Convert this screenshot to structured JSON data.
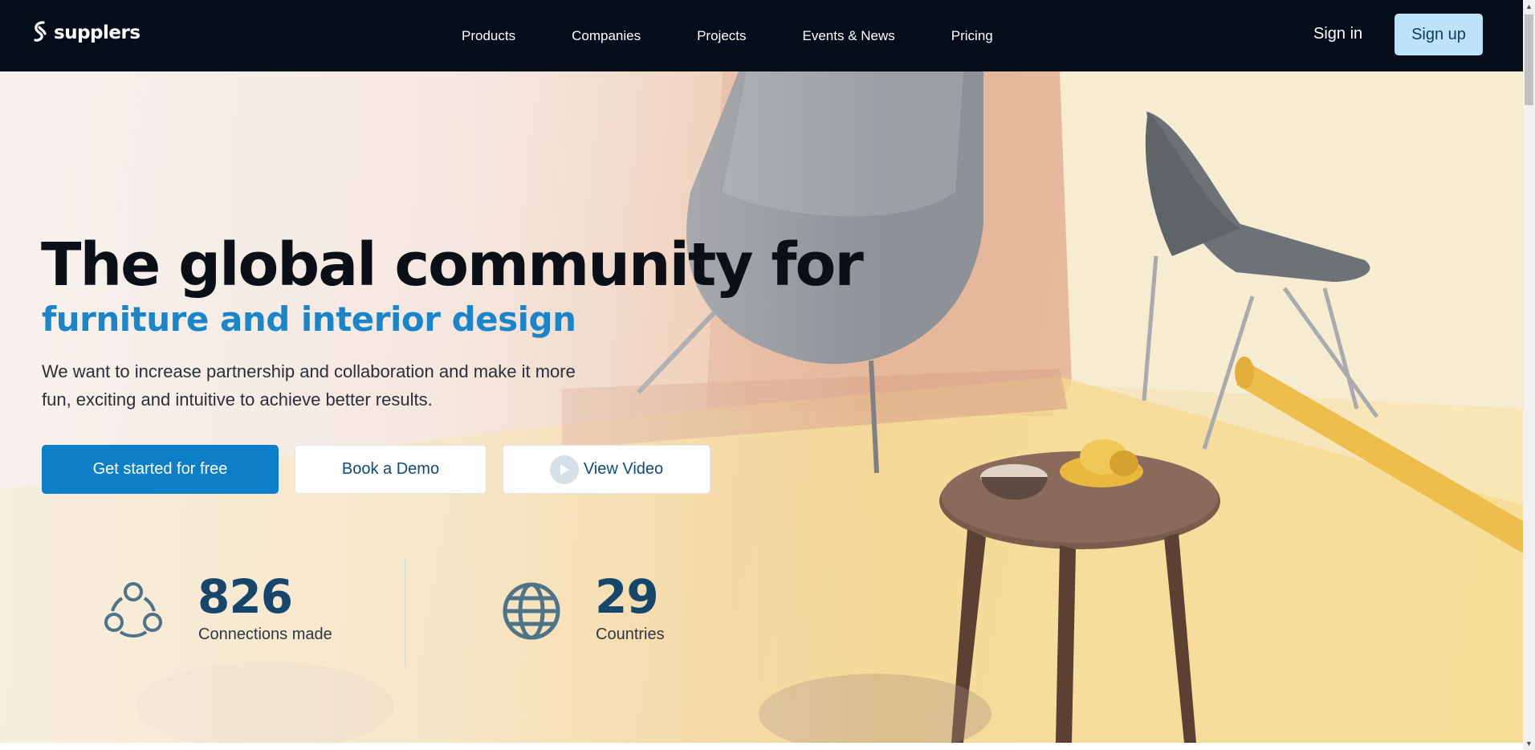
{
  "brand": {
    "name": "supplers"
  },
  "nav": {
    "items": [
      {
        "label": "Products"
      },
      {
        "label": "Companies"
      },
      {
        "label": "Projects"
      },
      {
        "label": "Events & News"
      },
      {
        "label": "Pricing"
      }
    ],
    "sign_in": "Sign in",
    "sign_up": "Sign up"
  },
  "hero": {
    "headline": "The global community for",
    "subheadline": "furniture and interior design",
    "lead": "We want to increase partnership and collaboration and make it more fun, exciting and intuitive to achieve better results.",
    "buttons": {
      "primary": "Get started for free",
      "demo": "Book a Demo",
      "video": "View Video"
    }
  },
  "stats": [
    {
      "value": "826",
      "label": "Connections made",
      "icon": "connections-icon"
    },
    {
      "value": "29",
      "label": "Countries",
      "icon": "globe-icon"
    }
  ],
  "colors": {
    "header_bg": "#050d1a",
    "accent": "#0c7fc8",
    "signup_bg": "#bde3fb",
    "subheadline": "#1a85c8",
    "stat_number": "#16466b"
  }
}
